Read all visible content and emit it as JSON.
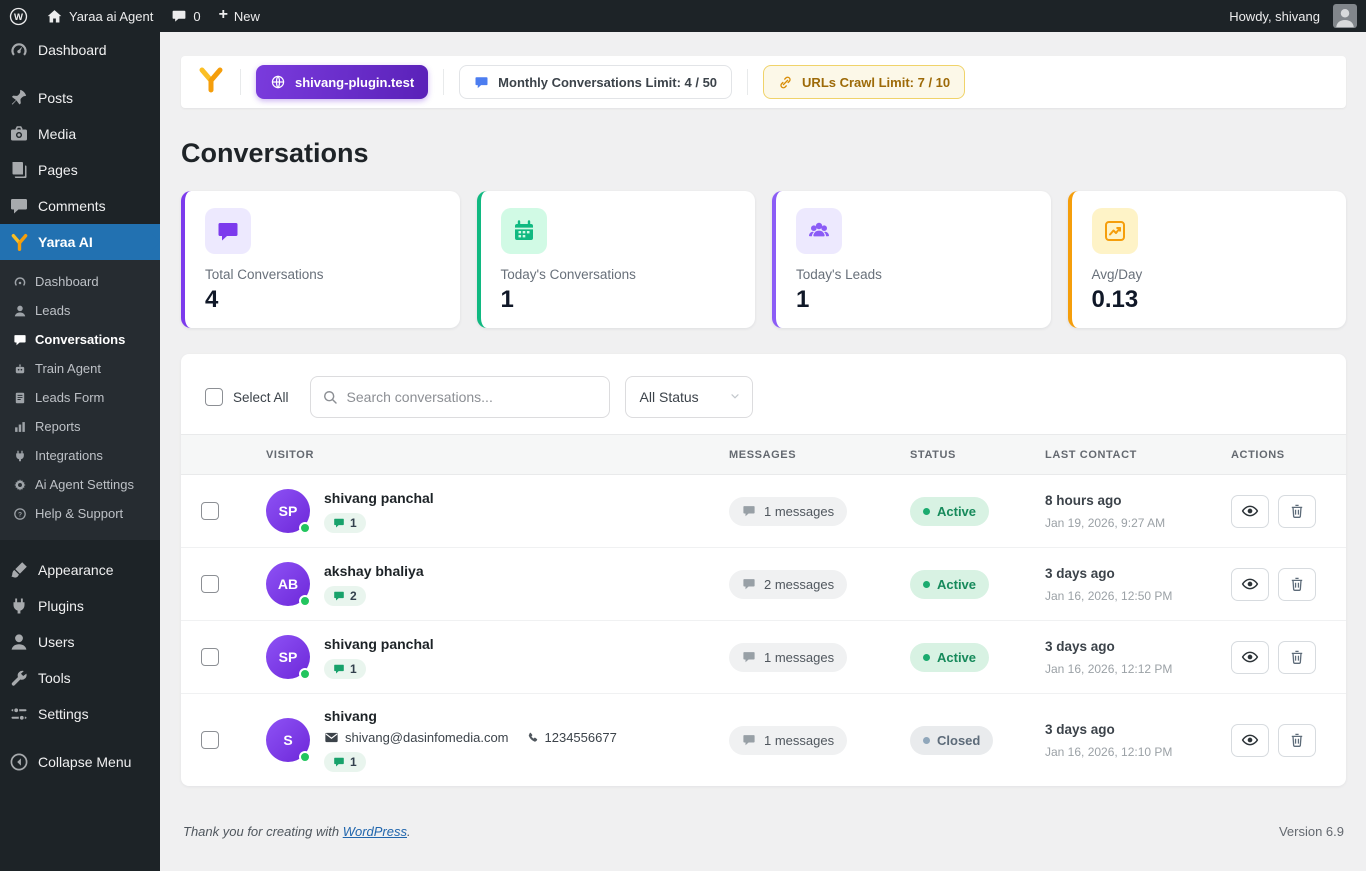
{
  "admin_bar": {
    "site_name": "Yaraa ai Agent",
    "comments_count": "0",
    "new_label": "New",
    "howdy": "Howdy, shivang"
  },
  "sidebar": {
    "items": [
      {
        "label": "Dashboard"
      },
      {
        "label": "Posts"
      },
      {
        "label": "Media"
      },
      {
        "label": "Pages"
      },
      {
        "label": "Comments"
      },
      {
        "label": "Yaraa AI"
      }
    ],
    "submenu": [
      {
        "label": "Dashboard"
      },
      {
        "label": "Leads"
      },
      {
        "label": "Conversations"
      },
      {
        "label": "Train Agent"
      },
      {
        "label": "Leads Form"
      },
      {
        "label": "Reports"
      },
      {
        "label": "Integrations"
      },
      {
        "label": "Ai Agent Settings"
      },
      {
        "label": "Help & Support"
      }
    ],
    "items_lower": [
      {
        "label": "Appearance"
      },
      {
        "label": "Plugins"
      },
      {
        "label": "Users"
      },
      {
        "label": "Tools"
      },
      {
        "label": "Settings"
      }
    ],
    "collapse_label": "Collapse Menu"
  },
  "header_bar": {
    "site_badge": "shivang-plugin.test",
    "monthly_limit": "Monthly Conversations Limit: 4 / 50",
    "crawl_limit": "URLs Crawl Limit: 7 / 10"
  },
  "page": {
    "title": "Conversations"
  },
  "stats": [
    {
      "label": "Total Conversations",
      "value": "4",
      "accent": "#7c3aed",
      "icon_bg": "#ede9fe",
      "icon": "chat-icon"
    },
    {
      "label": "Today's Conversations",
      "value": "1",
      "accent": "#10b981",
      "icon_bg": "#d1fae5",
      "icon": "calendar-icon"
    },
    {
      "label": "Today's Leads",
      "value": "1",
      "accent": "#8b5cf6",
      "icon_bg": "#ede9fe",
      "icon": "people-icon"
    },
    {
      "label": "Avg/Day",
      "value": "0.13",
      "accent": "#f59e0b",
      "icon_bg": "#fef3c7",
      "icon": "chart-icon"
    }
  ],
  "toolbar": {
    "select_all": "Select All",
    "search_placeholder": "Search conversations...",
    "status_filter": "All Status"
  },
  "table": {
    "headers": [
      "VISITOR",
      "MESSAGES",
      "STATUS",
      "LAST CONTACT",
      "ACTIONS"
    ],
    "rows": [
      {
        "initials": "SP",
        "name": "shivang panchal",
        "badge": "1",
        "messages": "1 messages",
        "status": "Active",
        "status_type": "active",
        "last_contact": "8 hours ago",
        "last_date": "Jan 19, 2026, 9:27 AM"
      },
      {
        "initials": "AB",
        "name": "akshay bhaliya",
        "badge": "2",
        "messages": "2 messages",
        "status": "Active",
        "status_type": "active",
        "last_contact": "3 days ago",
        "last_date": "Jan 16, 2026, 12:50 PM"
      },
      {
        "initials": "SP",
        "name": "shivang panchal",
        "badge": "1",
        "messages": "1 messages",
        "status": "Active",
        "status_type": "active",
        "last_contact": "3 days ago",
        "last_date": "Jan 16, 2026, 12:12 PM"
      },
      {
        "initials": "S",
        "name": "shivang",
        "email": "shivang@dasinfomedia.com",
        "phone": "1234556677",
        "badge": "1",
        "messages": "1 messages",
        "status": "Closed",
        "status_type": "closed",
        "last_contact": "3 days ago",
        "last_date": "Jan 16, 2026, 12:10 PM"
      }
    ]
  },
  "footer": {
    "thanks": "Thank you for creating with",
    "link": "WordPress",
    "suffix": ".",
    "version": "Version 6.9"
  },
  "colors": {
    "brand_purple": "#6d28d9",
    "wp_blue": "#2271b1",
    "active_green": "#1bab6f",
    "closed_gray": "#90a7bb",
    "amber": "#f59e0b",
    "online_dot": "#22c55e"
  }
}
